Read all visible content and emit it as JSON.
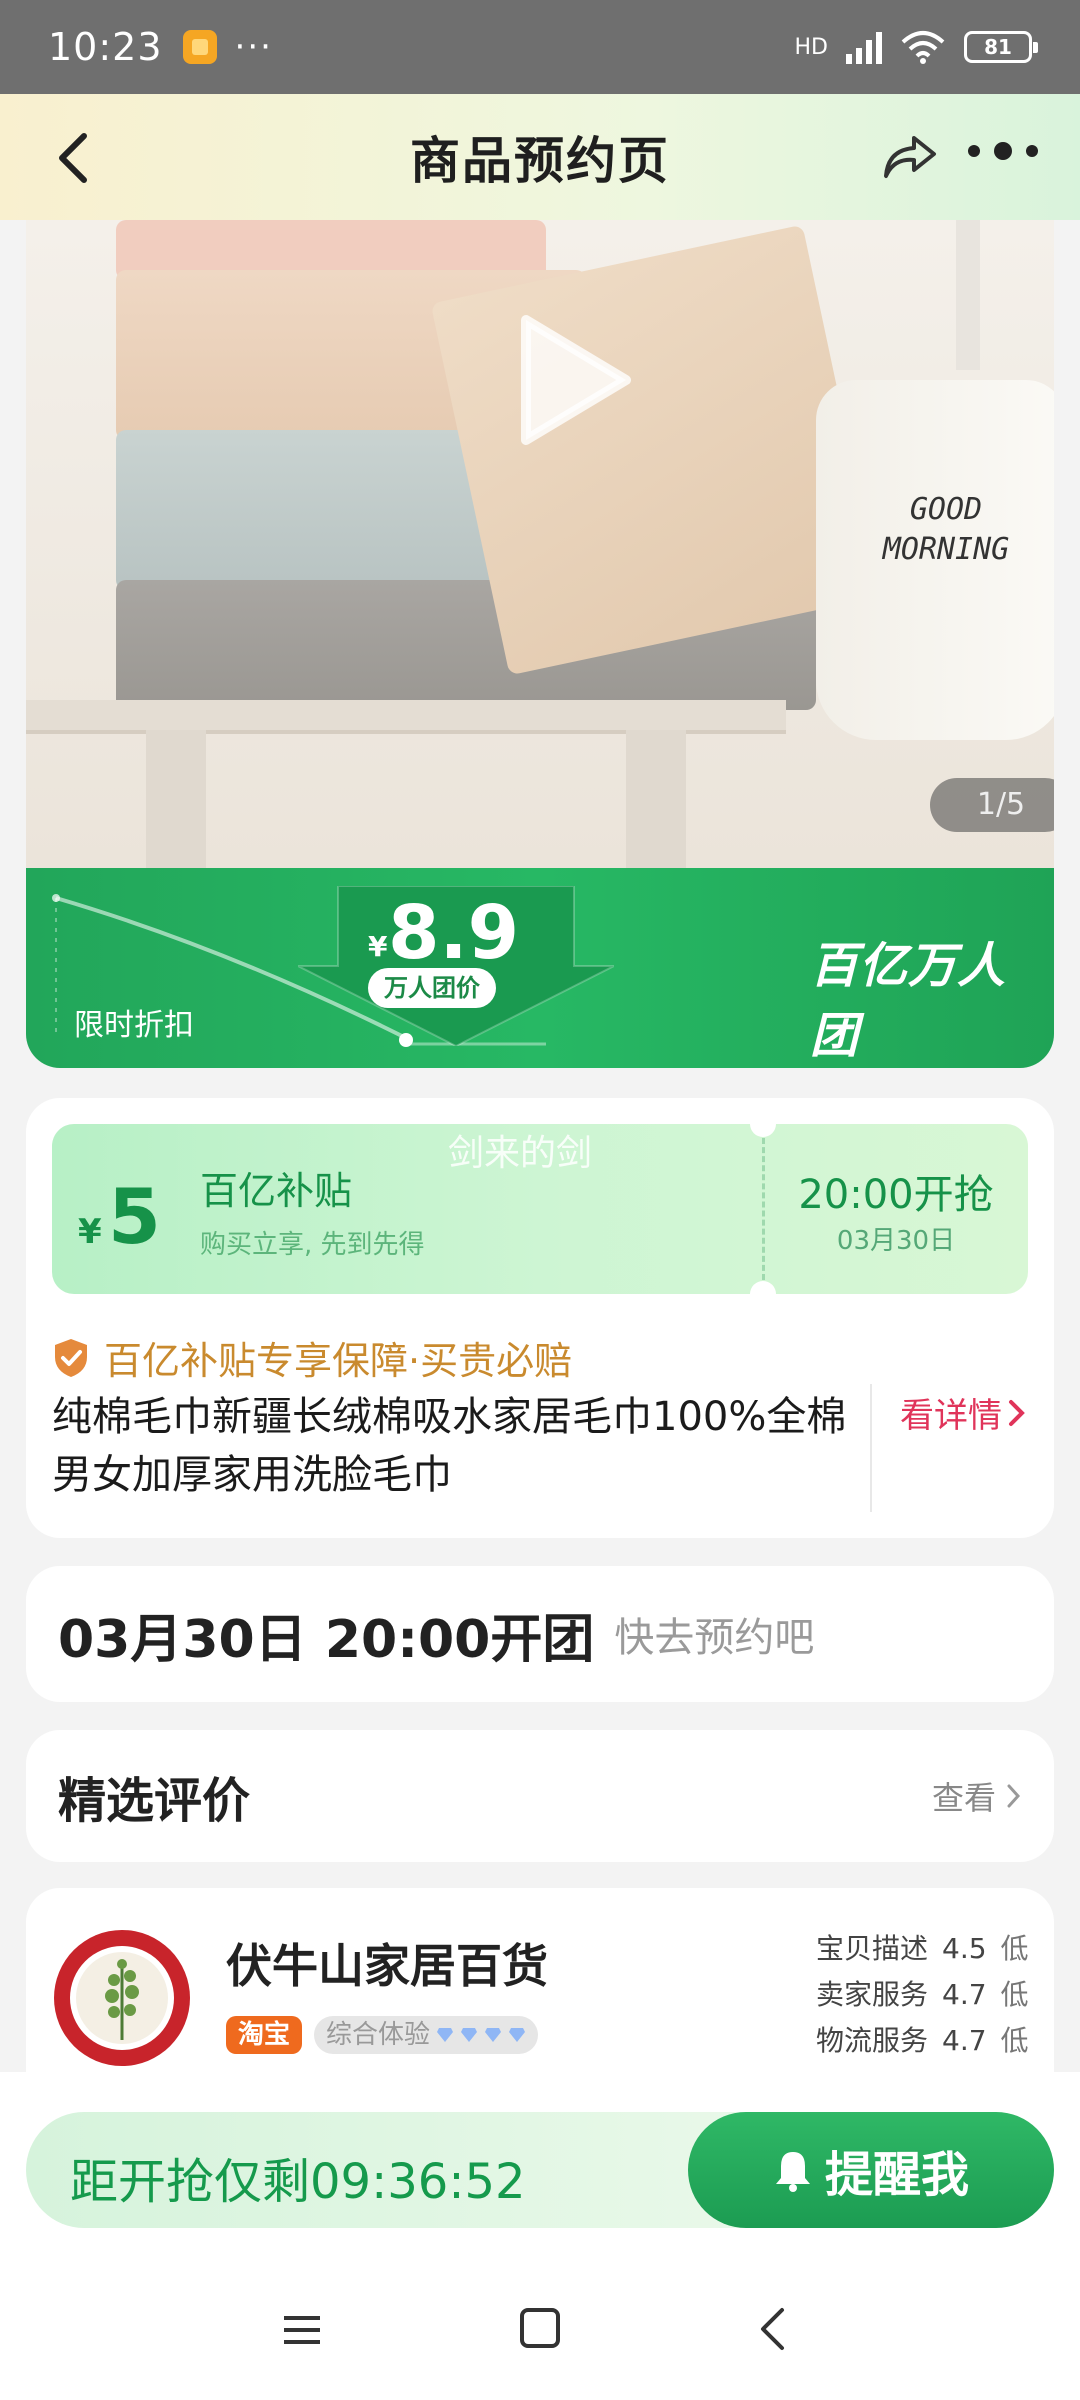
{
  "status": {
    "time": "10:23",
    "dots": "···",
    "network": "HD",
    "battery": "81"
  },
  "nav": {
    "title": "商品预约页"
  },
  "hero": {
    "counter": "1/5",
    "mug_line1": "GOOD",
    "mug_line2": "MORNING"
  },
  "price": {
    "currency": "¥",
    "value": "8.9",
    "tag": "万人团价",
    "limited": "限时折扣",
    "brand": "百亿万人团"
  },
  "coupon": {
    "currency": "¥",
    "amount": "5",
    "title": "百亿补贴",
    "subtitle": "购买立享, 先到先得",
    "watermark": "剑来的剑",
    "time": "20:00开抢",
    "date": "03月30日"
  },
  "guarantee": {
    "text": "百亿补贴专享保障·买贵必赔"
  },
  "product": {
    "title": "纯棉毛巾新疆长绒棉吸水家居毛巾100%全棉男女加厚家用洗脸毛巾",
    "detail_link": "看详情"
  },
  "open_time": {
    "when": "03月30日 20:00开团",
    "hint": "快去预约吧"
  },
  "reviews": {
    "title": "精选评价",
    "link": "查看"
  },
  "shop": {
    "name": "伏牛山家居百货",
    "platform": "淘宝",
    "experience": "综合体验",
    "scores": [
      {
        "label": "宝贝描述",
        "value": "4.5",
        "level": "低"
      },
      {
        "label": "卖家服务",
        "value": "4.7",
        "level": "低"
      },
      {
        "label": "物流服务",
        "value": "4.7",
        "level": "低"
      }
    ]
  },
  "bottom": {
    "countdown": "距开抢仅剩09:36:52",
    "remind": "提醒我"
  },
  "colors": {
    "brand_green": "#22a65a",
    "accent_red": "#e0345a",
    "gold": "#c98a2e"
  }
}
